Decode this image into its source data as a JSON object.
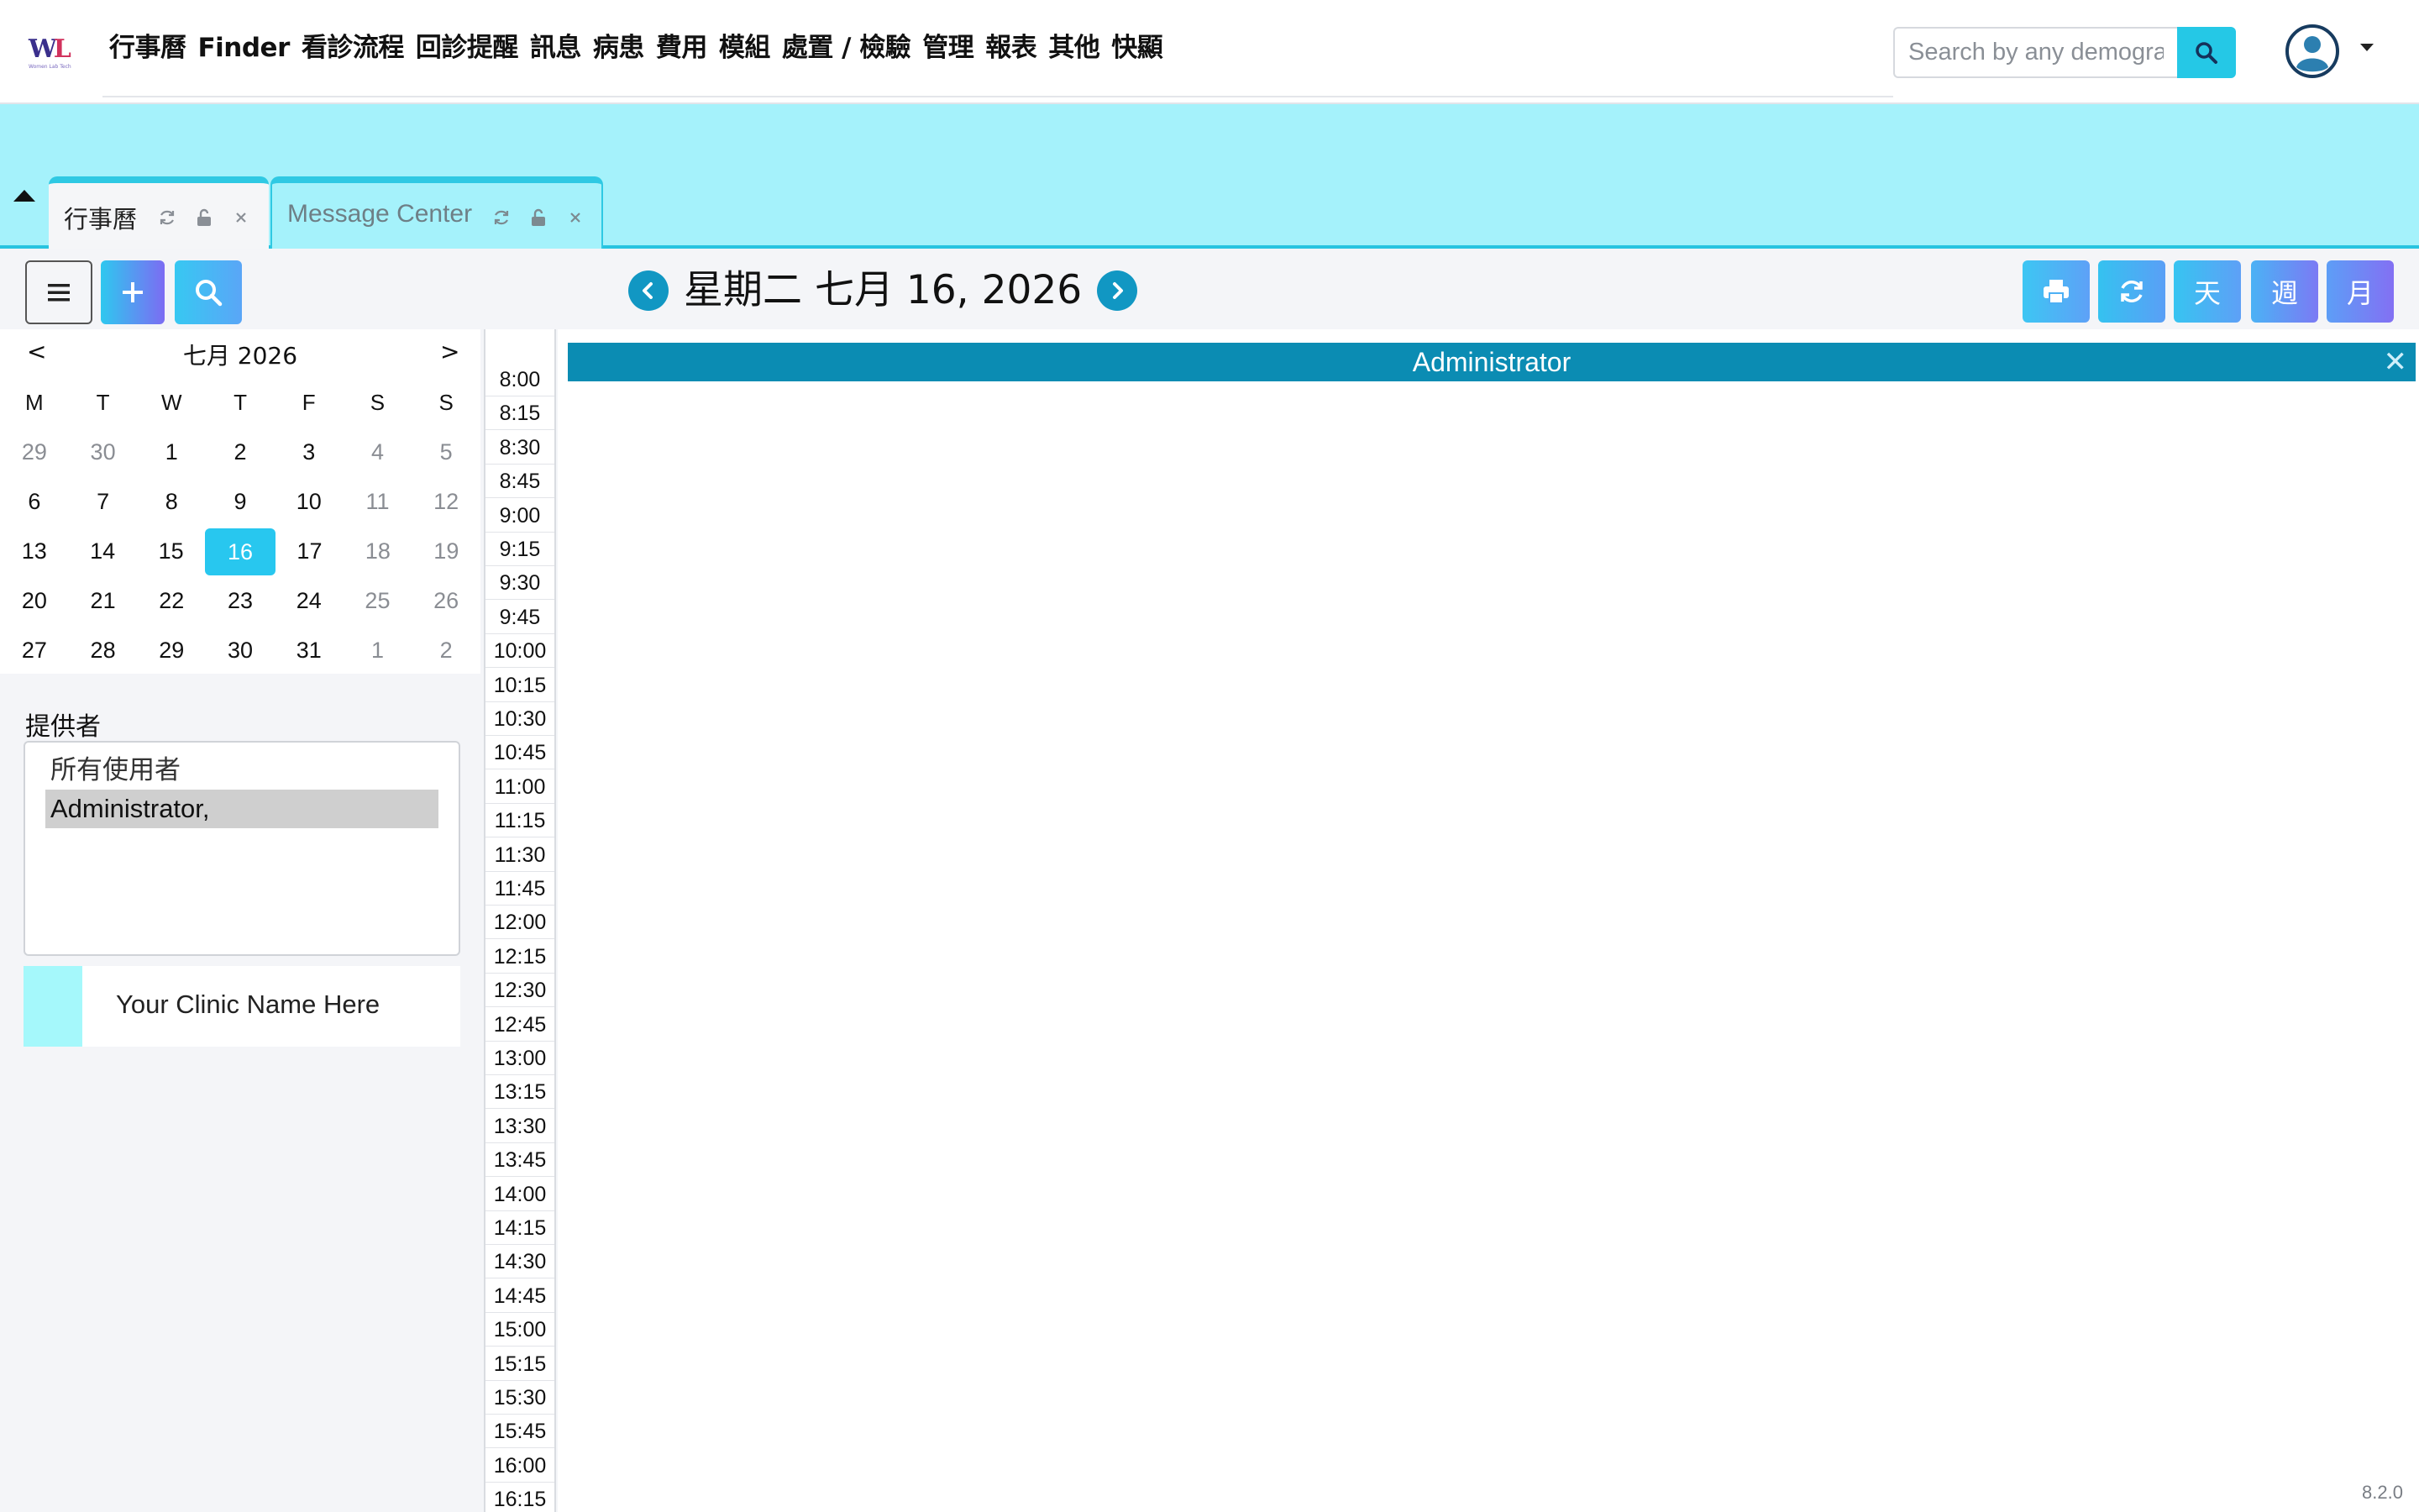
{
  "app": {
    "logo_text": "WL",
    "logo_subtitle": "Women Lab Tech",
    "version": "8.2.0"
  },
  "nav": {
    "items": [
      "行事曆",
      "Finder",
      "看診流程",
      "回診提醒",
      "訊息",
      "病患",
      "費用",
      "模組",
      "處置 / 檢驗",
      "管理",
      "報表",
      "其他",
      "快顯"
    ]
  },
  "search": {
    "placeholder": "Search by any demographics",
    "icon": "search-icon"
  },
  "user": {
    "icon": "user-circle-icon"
  },
  "tabs": [
    {
      "label": "行事曆",
      "active": true
    },
    {
      "label": "Message Center",
      "active": false
    }
  ],
  "toolbar": {
    "date_title": "星期二 七月 16, 2026",
    "right_buttons": [
      "print-icon",
      "refresh-icon",
      "天",
      "週",
      "月"
    ]
  },
  "mini_calendar": {
    "title": "七月 2026",
    "prev": "<",
    "next": ">",
    "weekdays": [
      "M",
      "T",
      "W",
      "T",
      "F",
      "S",
      "S"
    ],
    "weeks": [
      [
        "29",
        "30",
        "1",
        "2",
        "3",
        "4",
        "5"
      ],
      [
        "6",
        "7",
        "8",
        "9",
        "10",
        "11",
        "12"
      ],
      [
        "13",
        "14",
        "15",
        "16",
        "17",
        "18",
        "19"
      ],
      [
        "20",
        "21",
        "22",
        "23",
        "24",
        "25",
        "26"
      ],
      [
        "27",
        "28",
        "29",
        "30",
        "31",
        "1",
        "2"
      ]
    ],
    "selected": "16"
  },
  "providers": {
    "label": "提供者",
    "options": [
      "所有使用者",
      "Administrator,"
    ],
    "selected": "Administrator,"
  },
  "clinic": {
    "name": "Your Clinic Name Here",
    "color": "#a5f8fb"
  },
  "schedule": {
    "column_header": "Administrator",
    "close": "✕",
    "times": [
      "8:00",
      "8:15",
      "8:30",
      "8:45",
      "9:00",
      "9:15",
      "9:30",
      "9:45",
      "10:00",
      "10:15",
      "10:30",
      "10:45",
      "11:00",
      "11:15",
      "11:30",
      "11:45",
      "12:00",
      "12:15",
      "12:30",
      "12:45",
      "13:00",
      "13:15",
      "13:30",
      "13:45",
      "14:00",
      "14:15",
      "14:30",
      "14:45",
      "15:00",
      "15:15",
      "15:30",
      "15:45",
      "16:00",
      "16:15"
    ]
  },
  "colors": {
    "accent": "#27c4e0",
    "tab_strip": "#a5f2fb",
    "column_header": "#0b8cb3",
    "date_nav": "#1197c3"
  }
}
